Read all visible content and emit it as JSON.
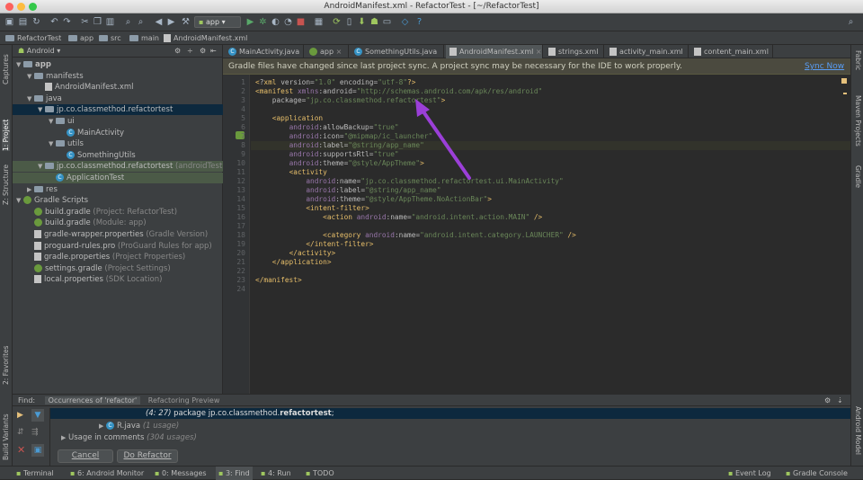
{
  "window": {
    "title": "AndroidManifest.xml - RefactorTest - [~/RefactorTest]"
  },
  "toolbar": {
    "run_config": "app"
  },
  "breadcrumb": [
    "RefactorTest",
    "app",
    "src",
    "main",
    "AndroidManifest.xml"
  ],
  "left_strip": {
    "top": [
      "Captures",
      "1: Project",
      "Z: Structure"
    ],
    "bottom": [
      "2: Favorites",
      "Build Variants"
    ]
  },
  "right_strip": {
    "items": [
      "Fabric",
      "Maven Projects",
      "Gradle",
      "Android Model"
    ]
  },
  "project_panel": {
    "view_mode": "Android",
    "tree": [
      {
        "indent": 0,
        "arrow": "▼",
        "icon": "folder",
        "label": "app",
        "hint": "",
        "bold": true
      },
      {
        "indent": 1,
        "arrow": "▼",
        "icon": "folder",
        "label": "manifests",
        "hint": ""
      },
      {
        "indent": 2,
        "arrow": "",
        "icon": "file",
        "label": "AndroidManifest.xml",
        "hint": ""
      },
      {
        "indent": 1,
        "arrow": "▼",
        "icon": "folder",
        "label": "java",
        "hint": ""
      },
      {
        "indent": 2,
        "arrow": "▼",
        "icon": "folder",
        "label": "jp.co.classmethod.refactortest",
        "hint": "",
        "selected": true
      },
      {
        "indent": 3,
        "arrow": "▼",
        "icon": "folder",
        "label": "ui",
        "hint": ""
      },
      {
        "indent": 4,
        "arrow": "",
        "icon": "class",
        "label": "MainActivity",
        "hint": ""
      },
      {
        "indent": 3,
        "arrow": "▼",
        "icon": "folder",
        "label": "utils",
        "hint": ""
      },
      {
        "indent": 4,
        "arrow": "",
        "icon": "class",
        "label": "SomethingUtils",
        "hint": ""
      },
      {
        "indent": 2,
        "arrow": "▼",
        "icon": "folder",
        "label": "jp.co.classmethod.refactortest",
        "hint": "(androidTest)",
        "highlight": true
      },
      {
        "indent": 3,
        "arrow": "",
        "icon": "class",
        "label": "ApplicationTest",
        "hint": "",
        "highlight": true
      },
      {
        "indent": 1,
        "arrow": "▶",
        "icon": "folder",
        "label": "res",
        "hint": ""
      },
      {
        "indent": 0,
        "arrow": "▼",
        "icon": "gradle",
        "label": "Gradle Scripts",
        "hint": ""
      },
      {
        "indent": 1,
        "arrow": "",
        "icon": "gradle",
        "label": "build.gradle",
        "hint": "(Project: RefactorTest)"
      },
      {
        "indent": 1,
        "arrow": "",
        "icon": "gradle",
        "label": "build.gradle",
        "hint": "(Module: app)"
      },
      {
        "indent": 1,
        "arrow": "",
        "icon": "file",
        "label": "gradle-wrapper.properties",
        "hint": "(Gradle Version)"
      },
      {
        "indent": 1,
        "arrow": "",
        "icon": "file",
        "label": "proguard-rules.pro",
        "hint": "(ProGuard Rules for app)"
      },
      {
        "indent": 1,
        "arrow": "",
        "icon": "file",
        "label": "gradle.properties",
        "hint": "(Project Properties)"
      },
      {
        "indent": 1,
        "arrow": "",
        "icon": "gradle",
        "label": "settings.gradle",
        "hint": "(Project Settings)"
      },
      {
        "indent": 1,
        "arrow": "",
        "icon": "file",
        "label": "local.properties",
        "hint": "(SDK Location)"
      }
    ]
  },
  "tabs": [
    {
      "label": "MainActivity.java",
      "icon": "class",
      "width": 88
    },
    {
      "label": "app",
      "icon": "gradle",
      "width": 48
    },
    {
      "label": "SomethingUtils.java",
      "icon": "class",
      "width": 104
    },
    {
      "label": "AndroidManifest.xml",
      "icon": "file",
      "width": 108,
      "active": true
    },
    {
      "label": "strings.xml",
      "icon": "file",
      "width": 66
    },
    {
      "label": "activity_main.xml",
      "icon": "file",
      "width": 92
    },
    {
      "label": "content_main.xml",
      "icon": "file",
      "width": 92
    }
  ],
  "notice": {
    "text": "Gradle files have changed since last project sync. A project sync may be necessary for the IDE to work properly.",
    "action": "Sync Now"
  },
  "code_lines": [
    "<?xml version=\"1.0\" encoding=\"utf-8\"?>",
    "<manifest xmlns:android=\"http://schemas.android.com/apk/res/android\"",
    "    package=\"jp.co.classmethod.refactortest\">",
    "",
    "    <application",
    "        android:allowBackup=\"true\"",
    "        android:icon=\"@mipmap/ic_launcher\"",
    "        android:label=\"@string/app_name\"",
    "        android:supportsRtl=\"true\"",
    "        android:theme=\"@style/AppTheme\">",
    "        <activity",
    "            android:name=\"jp.co.classmethod.refactortest.ui.MainActivity\"",
    "            android:label=\"@string/app_name\"",
    "            android:theme=\"@style/AppTheme.NoActionBar\">",
    "            <intent-filter>",
    "                <action android:name=\"android.intent.action.MAIN\" />",
    "",
    "                <category android:name=\"android.intent.category.LAUNCHER\" />",
    "            </intent-filter>",
    "        </activity>",
    "    </application>",
    "",
    "</manifest>",
    ""
  ],
  "find_panel": {
    "label": "Find:",
    "tabs": [
      "Occurrences of 'refactor'",
      "Refactoring Preview"
    ],
    "result_prefix": "(4: 27)",
    "result_text": "package jp.co.classmethod.",
    "result_bold": "refactortest",
    "result_suffix": ";",
    "child_item": "R.java",
    "child_usage": "(1 usage)",
    "comments_item": "Usage in comments",
    "comments_usage": "(304 usages)",
    "cancel_label": "Cancel",
    "do_refactor_label": "Do Refactor"
  },
  "status_bar": {
    "left": [
      {
        "label": "Terminal",
        "icon": "terminal-icon"
      },
      {
        "label": "6: Android Monitor",
        "icon": "android-icon"
      },
      {
        "label": "0: Messages",
        "icon": "messages-icon"
      },
      {
        "label": "3: Find",
        "icon": "find-icon",
        "active": true
      },
      {
        "label": "4: Run",
        "icon": "run-icon"
      },
      {
        "label": "TODO",
        "icon": "todo-icon"
      }
    ],
    "right": [
      {
        "label": "Event Log",
        "icon": "event-log-icon"
      },
      {
        "label": "Gradle Console",
        "icon": "gradle-console-icon"
      }
    ]
  },
  "annotation": {
    "color": "#9b3fd8"
  }
}
